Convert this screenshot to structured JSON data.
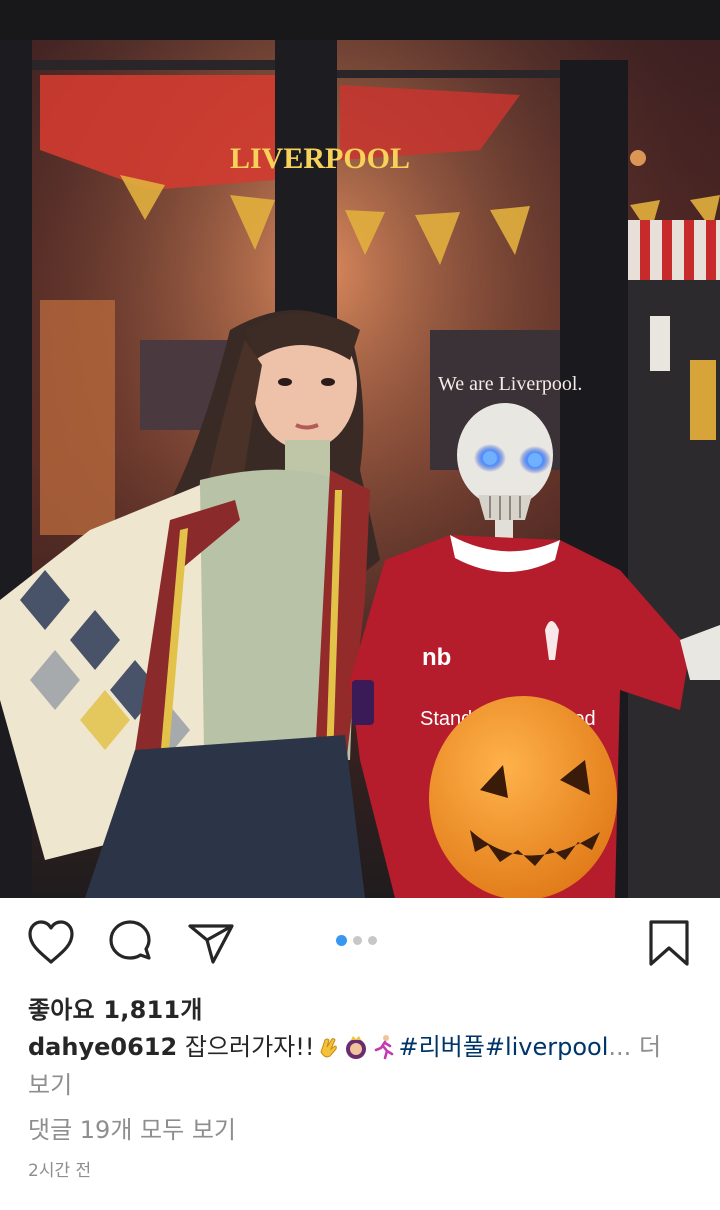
{
  "post": {
    "photo_text": {
      "banner_top": "LIVERPOOL",
      "wall_sign": "We are Liverpool.",
      "jersey_sponsor": "Standard Chartered",
      "jersey_brand": "nb"
    },
    "carousel": {
      "total": 3,
      "active": 1
    },
    "likes_label": "좋아요",
    "likes_count": "1,811",
    "likes_suffix": "개",
    "caption": {
      "username": "dahye0612",
      "text": "잡으러가자!!",
      "hashtag1": "#리버풀",
      "hashtag2": "#liverpool",
      "ellipsis": "...",
      "more_label": "더 보기"
    },
    "view_comments": "댓글 19개 모두 보기",
    "time_ago": "2시간 전"
  },
  "icons": {
    "like": "heart-icon",
    "comment": "comment-icon",
    "share": "paper-plane-icon",
    "save": "bookmark-icon"
  },
  "colors": {
    "hashtag": "#003569",
    "active_dot": "#3897f0",
    "muted_text": "#8e8e8e"
  }
}
